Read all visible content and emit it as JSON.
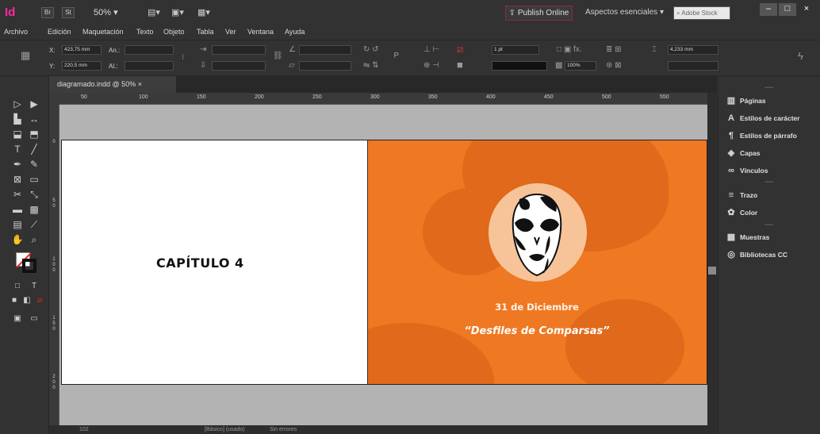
{
  "titlebar": {
    "app_logo": "Id",
    "bridge": "Br",
    "stock_chip": "St",
    "zoom": "50% ▾",
    "publish_online": "Publish Online",
    "workspace": "Aspectos esenciales ▾",
    "search_placeholder": "Adobe Stock",
    "minimize": "–",
    "maximize": "□",
    "close": "×"
  },
  "menu": [
    "Archivo",
    "Edición",
    "Maquetación",
    "Texto",
    "Objeto",
    "Tabla",
    "Ver",
    "Ventana",
    "Ayuda"
  ],
  "control": {
    "x_label": "X:",
    "y_label": "Y:",
    "x_value": "423,75 mm",
    "y_value": "220,5 mm",
    "w_label": "An.:",
    "h_label": "Al.:",
    "stroke_weight": "1 pt",
    "opacity": "100%",
    "gap_value": "4,233 mm"
  },
  "document_tab": "diagramado.indd @ 50%  ×",
  "ruler_ticks": [
    "50",
    "100",
    "150",
    "200",
    "250",
    "300",
    "350",
    "400",
    "450",
    "500",
    "550"
  ],
  "vruler_ticks": [
    "0",
    "5\n0",
    "1\n0\n0",
    "1\n5\n0",
    "2\n0\n0"
  ],
  "page_left": {
    "chapter": "CAPÍTULO 4"
  },
  "page_right": {
    "date": "31 de Diciembre",
    "title": "“Desfiles de Comparsas”"
  },
  "panels": [
    {
      "icon": "pages-icon",
      "label": "Páginas"
    },
    {
      "icon": "character-styles-icon",
      "label": "Estilos de carácter"
    },
    {
      "icon": "paragraph-styles-icon",
      "label": "Estilos de párrafo"
    },
    {
      "icon": "layers-icon",
      "label": "Capas"
    },
    {
      "icon": "links-icon",
      "label": "Vínculos"
    },
    {
      "icon": "stroke-icon",
      "label": "Trazo"
    },
    {
      "icon": "color-icon",
      "label": "Color"
    },
    {
      "icon": "swatches-icon",
      "label": "Muestras"
    },
    {
      "icon": "cc-libraries-icon",
      "label": "Bibliotecas CC"
    }
  ],
  "status": {
    "page": "102",
    "master": "[Básico] (usado)",
    "errors": "Sin errores"
  },
  "colors": {
    "orange": "#ef7822",
    "orange_dark": "#e0691b",
    "peach": "#f7c49a",
    "pasteboard": "#b3b3b3"
  }
}
